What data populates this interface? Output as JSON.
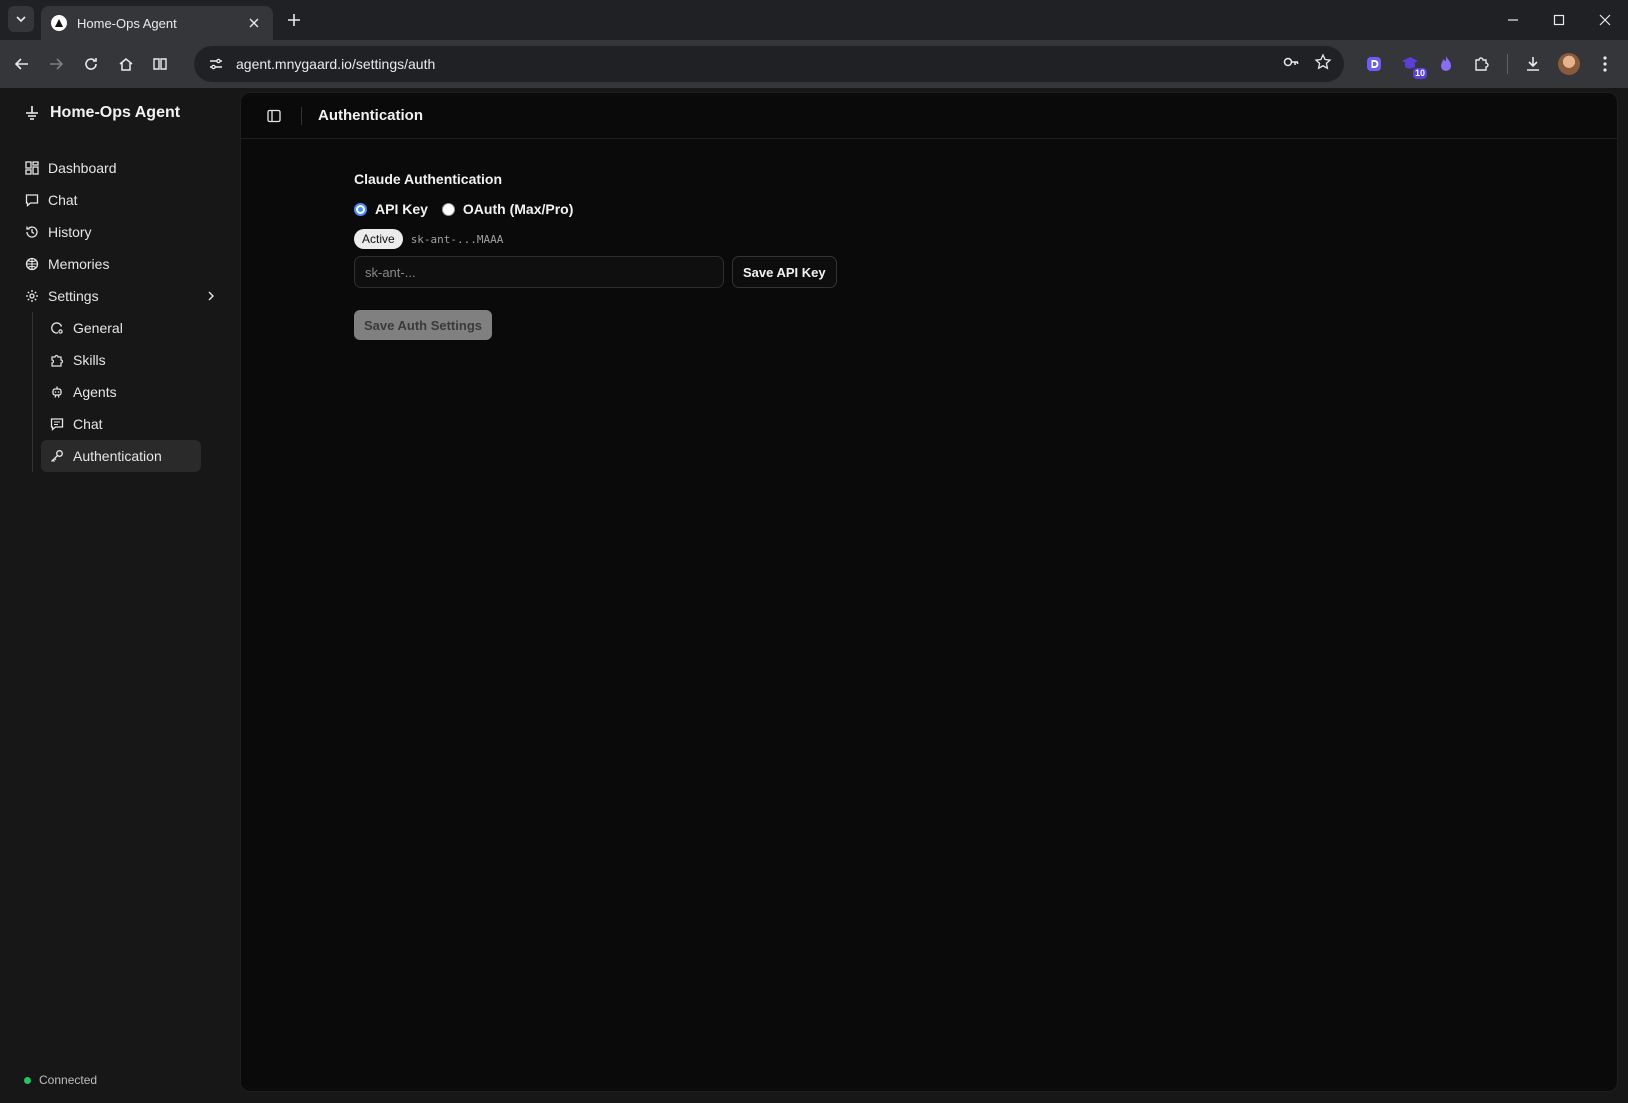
{
  "browser": {
    "tab_title": "Home-Ops Agent",
    "url": "agent.mnygaard.io/settings/auth",
    "extension_badge": "10"
  },
  "sidebar": {
    "brand": "Home-Ops Agent",
    "items": [
      {
        "label": "Dashboard",
        "icon": "dashboard-icon"
      },
      {
        "label": "Chat",
        "icon": "chat-icon"
      },
      {
        "label": "History",
        "icon": "history-icon"
      },
      {
        "label": "Memories",
        "icon": "memories-icon"
      },
      {
        "label": "Settings",
        "icon": "gear-icon"
      }
    ],
    "settings_items": [
      {
        "label": "General",
        "icon": "general-icon"
      },
      {
        "label": "Skills",
        "icon": "puzzle-icon"
      },
      {
        "label": "Agents",
        "icon": "bot-icon"
      },
      {
        "label": "Chat",
        "icon": "chat-icon"
      },
      {
        "label": "Authentication",
        "icon": "key-icon",
        "active": true
      }
    ],
    "status": "Connected",
    "status_color": "#22c55e"
  },
  "main": {
    "title": "Authentication",
    "section_title": "Claude Authentication",
    "auth_options": [
      {
        "label": "API Key",
        "selected": true
      },
      {
        "label": "OAuth (Max/Pro)",
        "selected": false
      }
    ],
    "active_badge": "Active",
    "masked_key": "sk-ant-...MAAA",
    "key_placeholder": "sk-ant-...",
    "save_key_label": "Save API Key",
    "save_auth_label": "Save Auth Settings"
  }
}
